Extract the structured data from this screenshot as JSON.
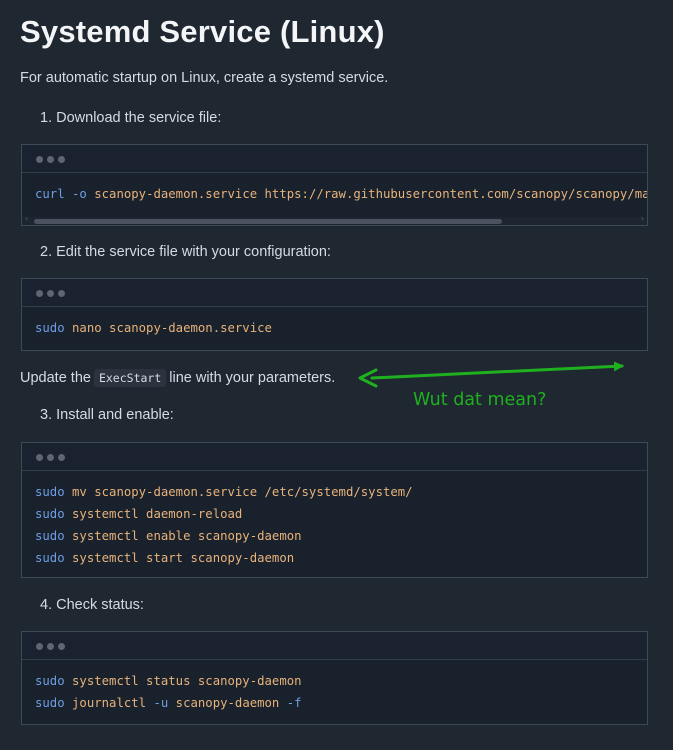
{
  "page": {
    "title": "Systemd Service (Linux)",
    "intro": "For automatic startup on Linux, create a systemd service.",
    "update_note": {
      "before": "Update the",
      "code": "ExecStart",
      "after": "line with your parameters."
    }
  },
  "steps": [
    {
      "label": "1. Download the service file:",
      "lines": [
        [
          {
            "t": "curl",
            "c": "cmd"
          },
          {
            "t": " "
          },
          {
            "t": "-o",
            "c": "flag"
          },
          {
            "t": " scanopy-daemon.service https://raw.githubusercontent.com/scanopy/scanopy/main/scanopy-daemon.service",
            "c": "arg"
          }
        ]
      ]
    },
    {
      "label": "2. Edit the service file with your configuration:",
      "lines": [
        [
          {
            "t": "sudo",
            "c": "cmd"
          },
          {
            "t": " nano scanopy-daemon.service",
            "c": "arg"
          }
        ]
      ]
    },
    {
      "label": "3. Install and enable:",
      "lines": [
        [
          {
            "t": "sudo",
            "c": "cmd"
          },
          {
            "t": " mv scanopy-daemon.service /etc/systemd/system/",
            "c": "arg"
          }
        ],
        [
          {
            "t": "sudo",
            "c": "cmd"
          },
          {
            "t": " systemctl daemon-reload",
            "c": "arg"
          }
        ],
        [
          {
            "t": "sudo",
            "c": "cmd"
          },
          {
            "t": " systemctl enable scanopy-daemon",
            "c": "arg"
          }
        ],
        [
          {
            "t": "sudo",
            "c": "cmd"
          },
          {
            "t": " systemctl start scanopy-daemon",
            "c": "arg"
          }
        ]
      ]
    },
    {
      "label": "4. Check status:",
      "lines": [
        [
          {
            "t": "sudo",
            "c": "cmd"
          },
          {
            "t": " systemctl status scanopy-daemon",
            "c": "arg"
          }
        ],
        [
          {
            "t": "sudo",
            "c": "cmd"
          },
          {
            "t": " journalctl ",
            "c": "arg"
          },
          {
            "t": "-u",
            "c": "flag"
          },
          {
            "t": " scanopy-daemon ",
            "c": "arg"
          },
          {
            "t": "-f",
            "c": "flag"
          }
        ]
      ]
    }
  ],
  "annotation": {
    "text": "Wut dat mean?",
    "color": "#1fb020"
  },
  "colors": {
    "background": "#1f2731",
    "code_background": "#18212c",
    "command": "#6e9ee3",
    "argument": "#e8b27a"
  },
  "icons": {
    "window_dots": "traffic-light-dots",
    "scroll_left": "chevron-left-icon",
    "scroll_right": "chevron-right-icon"
  }
}
